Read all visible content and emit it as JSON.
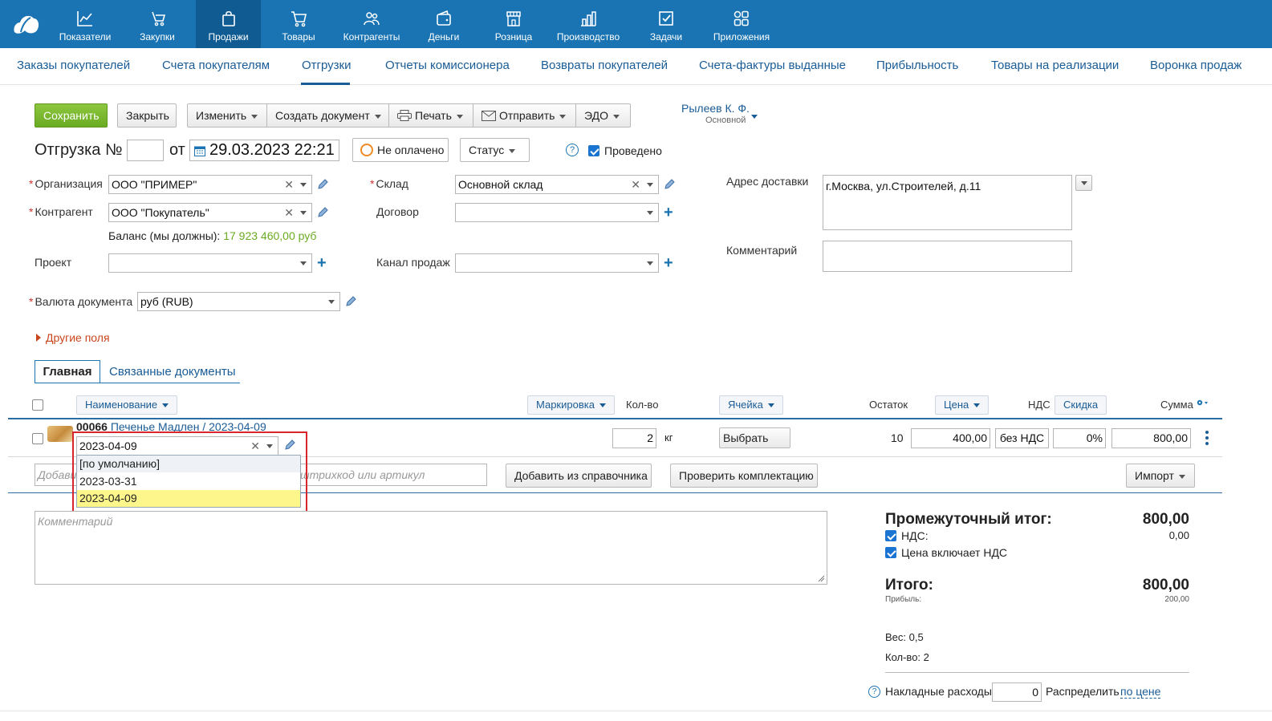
{
  "nav": {
    "items": [
      {
        "label": "Показатели",
        "icon": "chart-icon"
      },
      {
        "label": "Закупки",
        "icon": "purchases-icon"
      },
      {
        "label": "Продажи",
        "icon": "sales-bag-icon"
      },
      {
        "label": "Товары",
        "icon": "cart-icon"
      },
      {
        "label": "Контрагенты",
        "icon": "contacts-icon"
      },
      {
        "label": "Деньги",
        "icon": "wallet-icon"
      },
      {
        "label": "Розница",
        "icon": "store-icon"
      },
      {
        "label": "Производство",
        "icon": "factory-icon"
      },
      {
        "label": "Задачи",
        "icon": "tasks-icon"
      },
      {
        "label": "Приложения",
        "icon": "apps-icon"
      }
    ],
    "active": "Продажи"
  },
  "subnav": {
    "items": [
      "Заказы покупателей",
      "Счета покупателям",
      "Отгрузки",
      "Отчеты комиссионера",
      "Возвраты покупателей",
      "Счета-фактуры выданные",
      "Прибыльность",
      "Товары на реализации",
      "Воронка продаж"
    ],
    "active": "Отгрузки"
  },
  "toolbar": {
    "save": "Сохранить",
    "close": "Закрыть",
    "edit": "Изменить",
    "create_doc": "Создать документ",
    "print": "Печать",
    "send": "Отправить",
    "edo": "ЭДО"
  },
  "user": {
    "name": "Рылеев К. Ф.",
    "role": "Основной"
  },
  "doc": {
    "title": "Отгрузка №",
    "number": "",
    "from": "от",
    "date": "29.03.2023 22:21",
    "payment_status": "Не оплачено",
    "status_button": "Статус",
    "help": "?",
    "posted_label": "Проведено",
    "posted": true
  },
  "form": {
    "org_label": "Организация",
    "org_value": "ООО \"ПРИМЕР\"",
    "counterparty_label": "Контрагент",
    "counterparty_value": "ООО \"Покупатель\"",
    "balance_label": "Баланс (мы должны):",
    "balance_value": "17 923 460,00 руб",
    "project_label": "Проект",
    "project_value": "",
    "warehouse_label": "Склад",
    "warehouse_value": "Основной склад",
    "contract_label": "Договор",
    "contract_value": "",
    "channel_label": "Канал продаж",
    "channel_value": "",
    "currency_label": "Валюта документа",
    "currency_value": "руб (RUB)",
    "other_fields": "Другие поля",
    "address_label": "Адрес доставки",
    "address_value": "г.Москва, ул.Строителей, д.11",
    "comment_label": "Комментарий",
    "comment_value": ""
  },
  "tabs": {
    "main": "Главная",
    "related": "Связанные документы"
  },
  "table": {
    "headers": {
      "name": "Наименование",
      "marking": "Маркировка",
      "qty": "Кол-во",
      "cell": "Ячейка",
      "stock": "Остаток",
      "price": "Цена",
      "vat": "НДС",
      "discount": "Скидка",
      "sum": "Сумма"
    },
    "row": {
      "code": "00066",
      "name": "Печенье Мадлен / 2023-04-09",
      "batch": "2023-04-09",
      "qty": "2",
      "unit": "кг",
      "cell_button": "Выбрать",
      "stock": "10",
      "price": "400,00",
      "vat": "без НДС",
      "discount": "0%",
      "sum": "800,00"
    },
    "batch_options": [
      "[по умолчанию]",
      "2023-03-31",
      "2023-04-09"
    ],
    "batch_selected": "2023-04-09",
    "add_placeholder_left": "Добави",
    "add_placeholder_right": "штрихкод или артикул",
    "add_from_catalog": "Добавить из справочника",
    "check_kit": "Проверить комплектацию",
    "import": "Импорт"
  },
  "comment_placeholder": "Комментарий",
  "totals": {
    "subtotal_label": "Промежуточный итог:",
    "subtotal_value": "800,00",
    "vat_label": "НДС:",
    "vat_value": "0,00",
    "price_incl_vat_label": "Цена включает НДС",
    "total_label": "Итого:",
    "total_value": "800,00",
    "profit_label": "Прибыль:",
    "profit_value": "200,00",
    "weight": "Вес: 0,5",
    "count": "Кол-во: 2",
    "overhead_label": "Накладные расходы",
    "overhead_value": "0",
    "distribute_label": "Распределить",
    "distribute_link": "по цене"
  },
  "colors": {
    "nav_bg": "#1a74b3",
    "nav_active": "#0f5b92",
    "link": "#1a5c96",
    "save_green": "#7ab92f",
    "highlight_red": "#d9262c",
    "selected_yellow": "#fdf68b"
  }
}
